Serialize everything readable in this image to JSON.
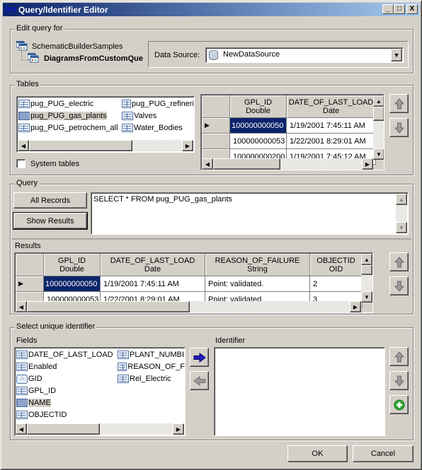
{
  "window": {
    "title": "Query/Identifier Editor",
    "icon_text": "Qry",
    "controls": {
      "minimize": "_",
      "maximize": "□",
      "close": "X"
    }
  },
  "edit_query": {
    "group_label": "Edit query for",
    "tree": [
      {
        "label": "SchematicBuilderSamples",
        "icon": "dataset-icon"
      },
      {
        "label": "DiagramsFromCustomQue",
        "icon": "diagram-template-icon",
        "bold": true
      }
    ],
    "data_source_label": "Data Source:",
    "data_source_value": "NewDataSource"
  },
  "tables": {
    "group_label": "Tables",
    "items": [
      {
        "label": "pug_PUG_electric",
        "selected": false
      },
      {
        "label": "pug_PUG_gas_plants",
        "selected": true
      },
      {
        "label": "pug_PUG_petrochem_all",
        "selected": false
      },
      {
        "label": "pug_PUG_refineri",
        "selected": false
      },
      {
        "label": "Valves",
        "selected": false
      },
      {
        "label": "Water_Bodies",
        "selected": false
      }
    ],
    "system_tables_label": "System tables",
    "system_tables_checked": false,
    "preview": {
      "columns": [
        {
          "name": "GPL_ID",
          "type": "Double"
        },
        {
          "name": "DATE_OF_LAST_LOAD",
          "type": "Date"
        }
      ],
      "rows": [
        [
          "100000000050",
          "1/19/2001 7:45:11 AM"
        ],
        [
          "100000000053",
          "1/22/2001 8:29:01 AM"
        ],
        [
          "100000000200",
          "1/19/2001 7:45:12 AM"
        ]
      ]
    }
  },
  "query": {
    "group_label": "Query",
    "all_records_label": "All Records",
    "show_results_label": "Show Results",
    "sql_text": "SELECT * FROM pug_PUG_gas_plants"
  },
  "results": {
    "label": "Results",
    "columns": [
      {
        "name": "GPL_ID",
        "type": "Double"
      },
      {
        "name": "DATE_OF_LAST_LOAD",
        "type": "Date"
      },
      {
        "name": "REASON_OF_FAILURE",
        "type": "String"
      },
      {
        "name": "OBJECTID",
        "type": "OID"
      }
    ],
    "rows": [
      [
        "100000000050",
        "1/19/2001 7:45:11 AM",
        "Point: validated.",
        "2"
      ],
      [
        "100000000053",
        "1/22/2001 8:29:01 AM",
        "Point: validated.",
        "3"
      ]
    ]
  },
  "identifier": {
    "group_label": "Select unique identifier",
    "fields_label": "Fields",
    "identifier_label": "Identifier",
    "fields": [
      {
        "label": "DATE_OF_LAST_LOAD",
        "icon": "field-icon",
        "selected": false
      },
      {
        "label": "Enabled",
        "icon": "field-icon",
        "selected": false
      },
      {
        "label": "GID",
        "icon": "gid-icon",
        "selected": false
      },
      {
        "label": "GPL_ID",
        "icon": "field-icon",
        "selected": false
      },
      {
        "label": "NAME",
        "icon": "field-icon",
        "selected": true
      },
      {
        "label": "OBJECTID",
        "icon": "field-icon",
        "selected": false
      },
      {
        "label": "PLANT_NUMBI",
        "icon": "field-icon",
        "selected": false
      },
      {
        "label": "REASON_OF_F",
        "icon": "field-icon",
        "selected": false
      },
      {
        "label": "Rel_Electric",
        "icon": "field-icon",
        "selected": false
      }
    ],
    "identifier_items": []
  },
  "footer": {
    "ok_label": "OK",
    "cancel_label": "Cancel"
  },
  "colors": {
    "selection": "#0a246a",
    "face": "#d4d0c8",
    "arrow_blue": "#2020c0",
    "add_green": "#2fa82f"
  }
}
